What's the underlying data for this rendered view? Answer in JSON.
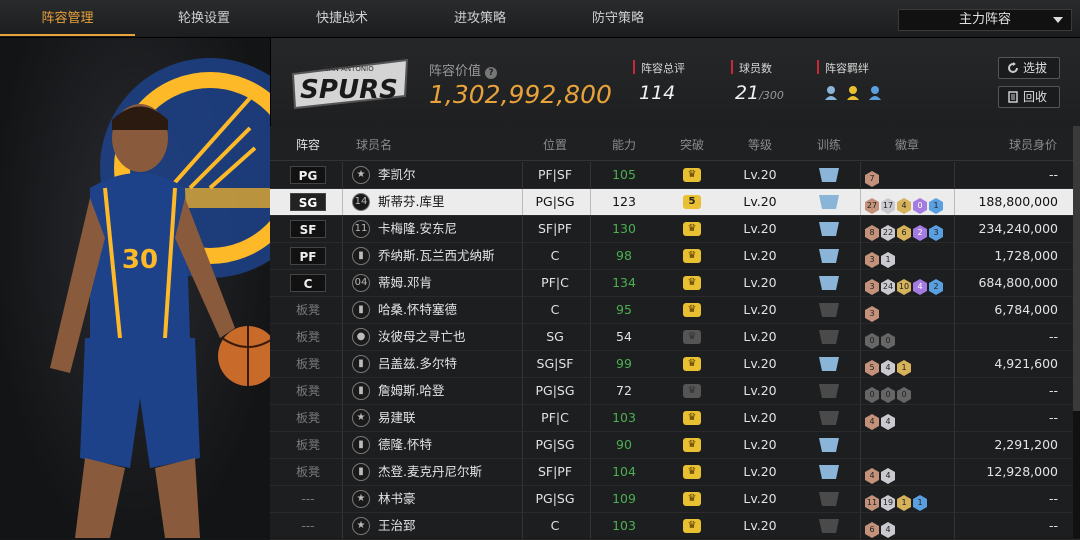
{
  "tabs": [
    {
      "label": "阵容管理",
      "active": true
    },
    {
      "label": "轮换设置"
    },
    {
      "label": "快捷战术"
    },
    {
      "label": "进攻策略"
    },
    {
      "label": "防守策略"
    }
  ],
  "lineup_select": {
    "value": "主力阵容"
  },
  "left_panel": {
    "style_label": "经典",
    "team_colors": {
      "primary": "#1d428a",
      "secondary": "#fdb927"
    }
  },
  "header": {
    "team_logo_text": "SPURS",
    "team_logo_subtext": "SAN ANTONIO",
    "value_label": "阵容价值",
    "value": "1,302,992,800",
    "value_color": "#e8a23a",
    "rating_label": "阵容总评",
    "rating": "114",
    "players_label": "球员数",
    "players": "21",
    "players_max": "/300",
    "bond_label": "阵容羁绊",
    "btn_pick": "选拔",
    "btn_recycle": "回收"
  },
  "columns": [
    "阵容",
    "球员名",
    "位置",
    "能力",
    "突破",
    "等级",
    "训练",
    "徽章",
    "球员身价"
  ],
  "players": [
    {
      "slot": "PG",
      "name": "李凯尔",
      "icon": "star-icon",
      "pos": "PF|SF",
      "ability": "105",
      "green": true,
      "breakthrough": "crown",
      "level": "Lv.20",
      "train": "blue",
      "badges": [
        [
          "br",
          "7"
        ]
      ],
      "value": "--"
    },
    {
      "slot": "SG",
      "name": "斯蒂芬.库里",
      "icon": "number-icon",
      "icon_text": "14",
      "pos": "PG|SG",
      "ability": "123",
      "green": false,
      "breakthrough": "5",
      "level": "Lv.20",
      "train": "blue",
      "badges": [
        [
          "br",
          "27"
        ],
        [
          "sv",
          "17"
        ],
        [
          "gd",
          "4"
        ],
        [
          "pu",
          "0"
        ],
        [
          "bl",
          "1"
        ]
      ],
      "value": "188,800,000",
      "selected": true
    },
    {
      "slot": "SF",
      "name": "卡梅隆.安东尼",
      "icon": "number-icon",
      "icon_text": "11",
      "pos": "SF|PF",
      "ability": "130",
      "green": true,
      "breakthrough": "crown",
      "level": "Lv.20",
      "train": "blue",
      "badges": [
        [
          "br",
          "8"
        ],
        [
          "sv",
          "22"
        ],
        [
          "gd",
          "6"
        ],
        [
          "pu",
          "2"
        ],
        [
          "bl",
          "3"
        ]
      ],
      "value": "234,240,000"
    },
    {
      "slot": "PF",
      "name": "乔纳斯.瓦兰西尤纳斯",
      "icon": "chart-icon",
      "pos": "C",
      "ability": "98",
      "green": true,
      "breakthrough": "crown",
      "level": "Lv.20",
      "train": "blue",
      "badges": [
        [
          "br",
          "3"
        ],
        [
          "sv",
          "1"
        ]
      ],
      "value": "1,728,000"
    },
    {
      "slot": "C",
      "name": "蒂姆.邓肯",
      "icon": "number-icon",
      "icon_text": "04",
      "pos": "PF|C",
      "ability": "134",
      "green": true,
      "breakthrough": "crown",
      "level": "Lv.20",
      "train": "blue",
      "badges": [
        [
          "br",
          "3"
        ],
        [
          "sv",
          "24"
        ],
        [
          "gd",
          "10"
        ],
        [
          "pu",
          "4"
        ],
        [
          "bl",
          "2"
        ]
      ],
      "value": "684,800,000"
    },
    {
      "slot": "板凳",
      "name": "哈桑.怀特塞德",
      "icon": "chart-icon",
      "pos": "C",
      "ability": "95",
      "green": true,
      "breakthrough": "crown",
      "level": "Lv.20",
      "train": "grey",
      "badges": [
        [
          "br",
          "3"
        ]
      ],
      "value": "6,784,000"
    },
    {
      "slot": "板凳",
      "name": "汝彼母之寻亡也",
      "icon": "person-icon",
      "pos": "SG",
      "ability": "54",
      "green": false,
      "breakthrough": "grey",
      "level": "Lv.20",
      "train": "grey",
      "badges": [
        [
          "gy",
          "0"
        ],
        [
          "gy",
          "0"
        ]
      ],
      "value": "--"
    },
    {
      "slot": "板凳",
      "name": "吕盖兹.多尔特",
      "icon": "chart-icon",
      "pos": "SG|SF",
      "ability": "99",
      "green": true,
      "breakthrough": "crown",
      "level": "Lv.20",
      "train": "blue",
      "badges": [
        [
          "br",
          "5"
        ],
        [
          "sv",
          "4"
        ],
        [
          "gd",
          "1"
        ]
      ],
      "value": "4,921,600"
    },
    {
      "slot": "板凳",
      "name": "詹姆斯.哈登",
      "icon": "chart-icon",
      "pos": "PG|SG",
      "ability": "72",
      "green": false,
      "breakthrough": "grey",
      "level": "Lv.20",
      "train": "grey",
      "badges": [
        [
          "gy",
          "0"
        ],
        [
          "gy",
          "0"
        ],
        [
          "gy",
          "0"
        ]
      ],
      "value": "--"
    },
    {
      "slot": "板凳",
      "name": "易建联",
      "icon": "star-icon",
      "pos": "PF|C",
      "ability": "103",
      "green": true,
      "breakthrough": "crown",
      "level": "Lv.20",
      "train": "grey",
      "badges": [
        [
          "br",
          "4"
        ],
        [
          "sv",
          "4"
        ]
      ],
      "value": "--"
    },
    {
      "slot": "板凳",
      "name": "德隆.怀特",
      "icon": "chart-icon",
      "pos": "PG|SG",
      "ability": "90",
      "green": true,
      "breakthrough": "crown",
      "level": "Lv.20",
      "train": "blue",
      "badges": [],
      "value": "2,291,200"
    },
    {
      "slot": "板凳",
      "name": "杰登.麦克丹尼尔斯",
      "icon": "chart-icon",
      "pos": "SF|PF",
      "ability": "104",
      "green": true,
      "breakthrough": "crown",
      "level": "Lv.20",
      "train": "blue",
      "badges": [
        [
          "br",
          "4"
        ],
        [
          "sv",
          "4"
        ]
      ],
      "value": "12,928,000"
    },
    {
      "slot": "---",
      "name": "林书豪",
      "icon": "star-icon",
      "pos": "PG|SG",
      "ability": "109",
      "green": true,
      "breakthrough": "crown",
      "level": "Lv.20",
      "train": "grey",
      "badges": [
        [
          "br",
          "11"
        ],
        [
          "sv",
          "19"
        ],
        [
          "gd",
          "1"
        ],
        [
          "bl",
          "1"
        ]
      ],
      "value": "--"
    },
    {
      "slot": "---",
      "name": "王治郅",
      "icon": "star-icon",
      "pos": "C",
      "ability": "103",
      "green": true,
      "breakthrough": "crown",
      "level": "Lv.20",
      "train": "grey",
      "badges": [
        [
          "br",
          "6"
        ],
        [
          "sv",
          "4"
        ]
      ],
      "value": "--"
    }
  ]
}
